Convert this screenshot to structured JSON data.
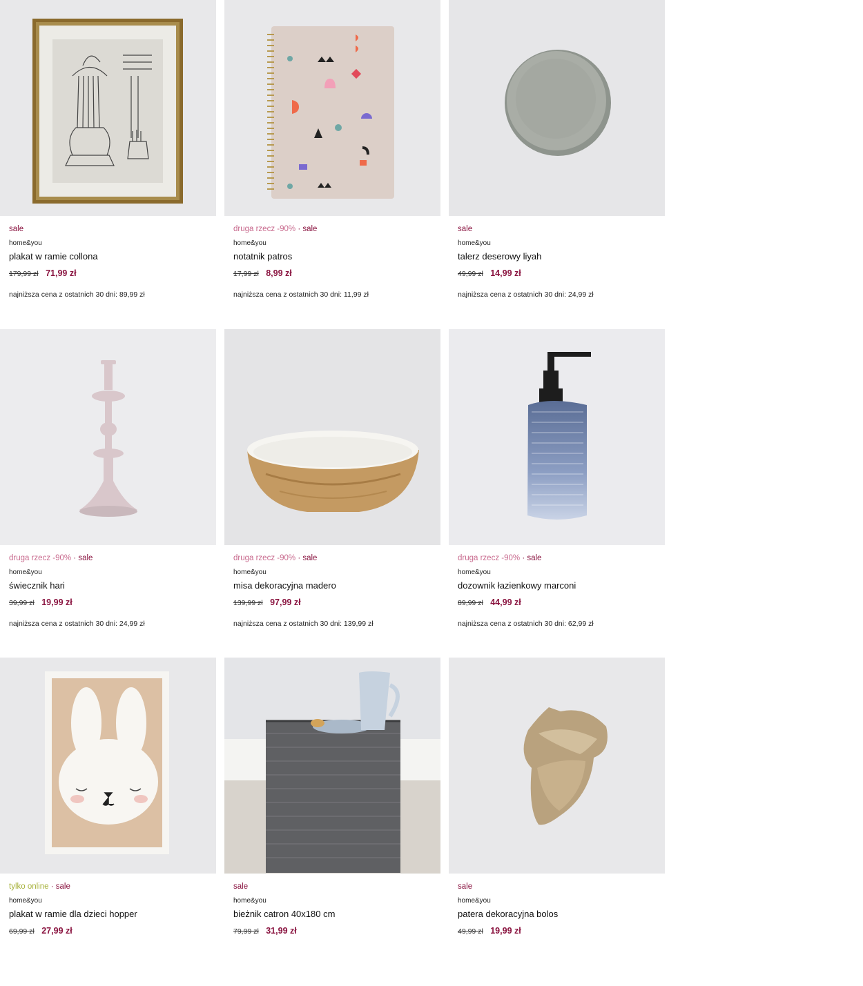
{
  "products": [
    {
      "tags": [
        {
          "text": "sale",
          "kind": "sale"
        }
      ],
      "brand": "home&you",
      "name": "plakat w ramie collona",
      "old_price": "179,99 zł",
      "new_price": "71,99 zł",
      "lowest_label": "najniższa cena z ostatnich 30 dni: 89,99 zł",
      "image": "framed-column-poster"
    },
    {
      "tags": [
        {
          "text": "druga rzecz -90%",
          "kind": "promo"
        },
        {
          "text": "sale",
          "kind": "sale"
        }
      ],
      "brand": "home&you",
      "name": "notatnik patros",
      "old_price": "17,99 zł",
      "new_price": "8,99 zł",
      "lowest_label": "najniższa cena z ostatnich 30 dni: 11,99 zł",
      "image": "spiral-notebook"
    },
    {
      "tags": [
        {
          "text": "sale",
          "kind": "sale"
        }
      ],
      "brand": "home&you",
      "name": "talerz deserowy liyah",
      "old_price": "49,99 zł",
      "new_price": "14,99 zł",
      "lowest_label": "najniższa cena z ostatnich 30 dni: 24,99 zł",
      "image": "dessert-plate"
    },
    {
      "tags": [
        {
          "text": "druga rzecz -90%",
          "kind": "promo"
        },
        {
          "text": "sale",
          "kind": "sale"
        }
      ],
      "brand": "home&you",
      "name": "świecznik hari",
      "old_price": "39,99 zł",
      "new_price": "19,99 zł",
      "lowest_label": "najniższa cena z ostatnich 30 dni: 24,99 zł",
      "image": "candle-holder"
    },
    {
      "tags": [
        {
          "text": "druga rzecz -90%",
          "kind": "promo"
        },
        {
          "text": "sale",
          "kind": "sale"
        }
      ],
      "brand": "home&you",
      "name": "misa dekoracyjna madero",
      "old_price": "139,99 zł",
      "new_price": "97,99 zł",
      "lowest_label": "najniższa cena z ostatnich 30 dni: 139,99 zł",
      "image": "wooden-bowl"
    },
    {
      "tags": [
        {
          "text": "druga rzecz -90%",
          "kind": "promo"
        },
        {
          "text": "sale",
          "kind": "sale"
        }
      ],
      "brand": "home&you",
      "name": "dozownik łazienkowy marconi",
      "old_price": "89,99 zł",
      "new_price": "44,99 zł",
      "lowest_label": "najniższa cena z ostatnich 30 dni: 62,99 zł",
      "image": "soap-dispenser"
    },
    {
      "tags": [
        {
          "text": "tylko online",
          "kind": "online"
        },
        {
          "text": "sale",
          "kind": "sale"
        }
      ],
      "brand": "home&you",
      "name": "plakat w ramie dla dzieci hopper",
      "old_price": "69,99 zł",
      "new_price": "27,99 zł",
      "lowest_label": "",
      "image": "bunny-poster"
    },
    {
      "tags": [
        {
          "text": "sale",
          "kind": "sale"
        }
      ],
      "brand": "home&you",
      "name": "bieżnik catron 40x180 cm",
      "old_price": "79,99 zł",
      "new_price": "31,99 zł",
      "lowest_label": "",
      "image": "table-runner"
    },
    {
      "tags": [
        {
          "text": "sale",
          "kind": "sale"
        }
      ],
      "brand": "home&you",
      "name": "patera dekoracyjna bolos",
      "old_price": "49,99 zł",
      "new_price": "19,99 zł",
      "lowest_label": "",
      "image": "acorn-tray"
    }
  ],
  "colors": {
    "sale": "#8a1440",
    "promo": "#c8698d",
    "online": "#a6b13a"
  }
}
